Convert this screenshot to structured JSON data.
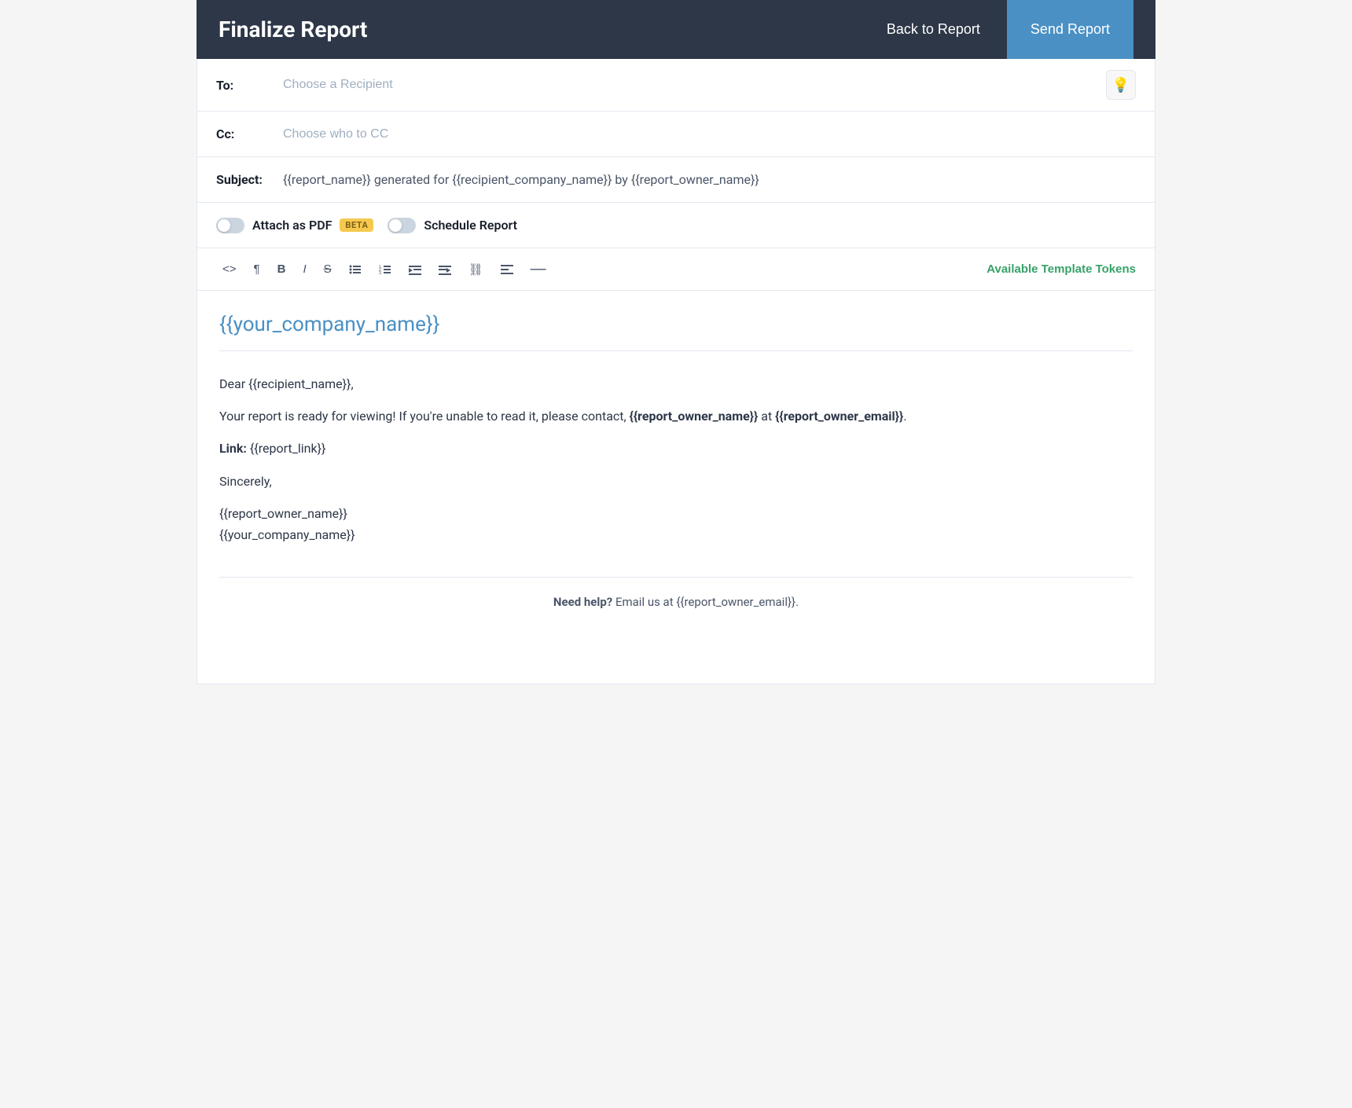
{
  "header": {
    "title": "Finalize Report",
    "back_button_label": "Back to Report",
    "send_button_label": "Send Report"
  },
  "form": {
    "to_label": "To:",
    "to_placeholder": "Choose a Recipient",
    "cc_label": "Cc:",
    "cc_placeholder": "Choose who to CC",
    "subject_label": "Subject:",
    "subject_value": "{{report_name}} generated for {{recipient_company_name}} by {{report_owner_name}}"
  },
  "options": {
    "attach_pdf_label": "Attach as PDF",
    "beta_label": "BETA",
    "schedule_report_label": "Schedule Report"
  },
  "toolbar": {
    "available_tokens_label": "Available Template Tokens",
    "buttons": [
      {
        "name": "code-icon",
        "symbol": "<>"
      },
      {
        "name": "paragraph-icon",
        "symbol": "¶"
      },
      {
        "name": "bold-icon",
        "symbol": "B"
      },
      {
        "name": "italic-icon",
        "symbol": "I"
      },
      {
        "name": "strikethrough-icon",
        "symbol": "S"
      },
      {
        "name": "unordered-list-icon",
        "symbol": "≡"
      },
      {
        "name": "ordered-list-icon",
        "symbol": "≣"
      },
      {
        "name": "outdent-icon",
        "symbol": "⇤"
      },
      {
        "name": "indent-icon",
        "symbol": "⇥"
      },
      {
        "name": "link-icon",
        "symbol": "⛓"
      },
      {
        "name": "align-icon",
        "symbol": "≡"
      },
      {
        "name": "hr-icon",
        "symbol": "—"
      }
    ]
  },
  "email_body": {
    "company_name": "{{your_company_name}}",
    "greeting": "Dear {{recipient_name}},",
    "body_text": "Your report is ready for viewing! If you're unable to read it, please contact, ",
    "owner_name_token": "{{report_owner_name}}",
    "at_text": " at ",
    "owner_email_token": "{{report_owner_email}}",
    "period": ".",
    "link_label": "Link: ",
    "link_token": "{{report_link}}",
    "sincerely": "Sincerely,",
    "sign_owner": "{{report_owner_name}}",
    "sign_company": "{{your_company_name}}"
  },
  "footer": {
    "need_help_bold": "Need help?",
    "footer_text": " Email us at {{report_owner_email}}."
  }
}
